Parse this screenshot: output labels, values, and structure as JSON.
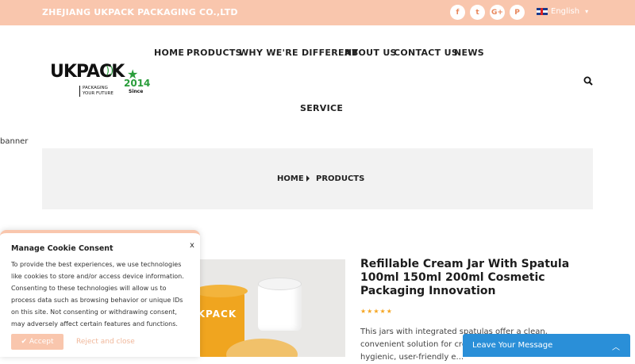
{
  "topbar": {
    "company": "ZHEJIANG UKPACK PACKAGING CO.,LTD",
    "social": [
      {
        "icon": "facebook-icon",
        "glyph": "f"
      },
      {
        "icon": "twitter-icon",
        "glyph": "t"
      },
      {
        "icon": "google-plus-icon",
        "glyph": "G+"
      },
      {
        "icon": "pinterest-icon",
        "glyph": "P"
      }
    ],
    "language": "English",
    "language_caret": "▾"
  },
  "logo": {
    "brand": "UKPACK",
    "tagline_1": "PACKAGING",
    "tagline_2": "YOUR FUTURE",
    "since_year": "2014",
    "since_label": "Since"
  },
  "nav": {
    "items": [
      "HOME",
      "PRODUCTS",
      "WHY WE'RE DIFFERENT",
      "ABOUT US",
      "CONTACT US",
      "NEWS",
      "SERVICE"
    ]
  },
  "banner": {
    "alt": "banner"
  },
  "breadcrumb": {
    "home": "HOME",
    "current": "PRODUCTS"
  },
  "product": {
    "title": "Refillable Cream Jar With Spatula 100ml 150ml 200ml Cosmetic Packaging Innovation",
    "stars": "★★★★★",
    "description": "This jars with integrated spatulas offer a clean, convenient solution for creams, balms, and more hygienic, user-friendly e...",
    "image_text": "UKPACK"
  },
  "cookie": {
    "title": "Manage Cookie Consent",
    "close": "x",
    "body": "To provide the best experiences, we use technologies like cookies to store and/or access device information. Consenting to these technologies will allow us to process data such as browsing behavior or unique IDs on this site. Not consenting or withdrawing consent, may adversely affect certain features and functions.",
    "accept": "✔ Accept",
    "reject": "Reject and close"
  },
  "message": {
    "label": "Leave Your Message",
    "chevron": "︿"
  },
  "colors": {
    "topbar": "#f9c6ad",
    "accent_blue": "#2a8fd8",
    "star": "#f5a623",
    "logo_green": "#2a9d3b"
  }
}
